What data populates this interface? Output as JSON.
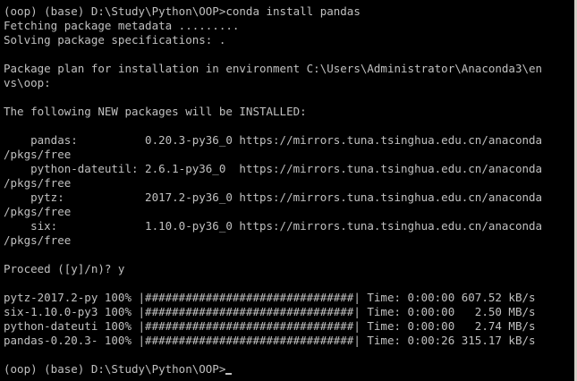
{
  "console": {
    "lines": [
      "(oop) (base) D:\\Study\\Python\\OOP>conda install pandas",
      "Fetching package metadata .........",
      "Solving package specifications: .",
      "",
      "Package plan for installation in environment C:\\Users\\Administrator\\Anaconda3\\en",
      "vs\\oop:",
      "",
      "The following NEW packages will be INSTALLED:",
      "",
      "    pandas:          0.20.3-py36_0 https://mirrors.tuna.tsinghua.edu.cn/anaconda",
      "/pkgs/free",
      "    python-dateutil: 2.6.1-py36_0  https://mirrors.tuna.tsinghua.edu.cn/anaconda",
      "/pkgs/free",
      "    pytz:            2017.2-py36_0 https://mirrors.tuna.tsinghua.edu.cn/anaconda",
      "/pkgs/free",
      "    six:             1.10.0-py36_0 https://mirrors.tuna.tsinghua.edu.cn/anaconda",
      "/pkgs/free",
      "",
      "Proceed ([y]/n)? y",
      "",
      "pytz-2017.2-py 100% |###############################| Time: 0:00:00 607.52 kB/s",
      "six-1.10.0-py3 100% |###############################| Time: 0:00:00   2.50 MB/s",
      "python-dateuti 100% |###############################| Time: 0:00:00   2.74 MB/s",
      "pandas-0.20.3- 100% |###############################| Time: 0:00:26 315.17 kB/s",
      "",
      "(oop) (base) D:\\Study\\Python\\OOP>"
    ]
  }
}
